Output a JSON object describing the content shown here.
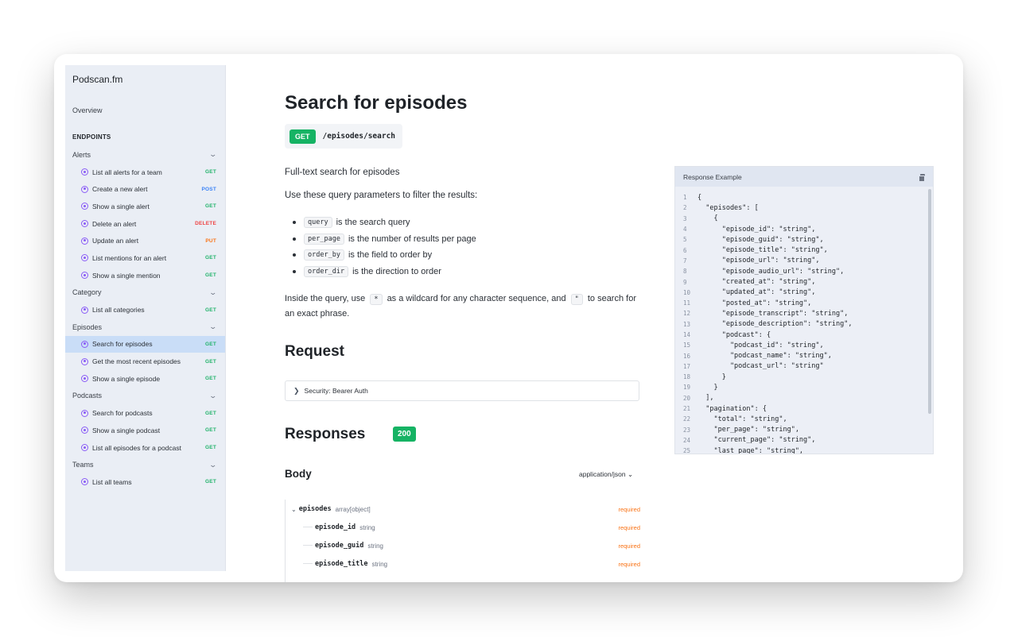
{
  "sidebar": {
    "brand": "Podscan.fm",
    "overview": "Overview",
    "endpoints_heading": "ENDPOINTS",
    "groups": [
      {
        "label": "Alerts",
        "items": [
          {
            "label": "List all alerts for a team",
            "method": "GET"
          },
          {
            "label": "Create a new alert",
            "method": "POST"
          },
          {
            "label": "Show a single alert",
            "method": "GET"
          },
          {
            "label": "Delete an alert",
            "method": "DELETE"
          },
          {
            "label": "Update an alert",
            "method": "PUT"
          },
          {
            "label": "List mentions for an alert",
            "method": "GET"
          },
          {
            "label": "Show a single mention",
            "method": "GET"
          }
        ]
      },
      {
        "label": "Category",
        "items": [
          {
            "label": "List all categories",
            "method": "GET"
          }
        ]
      },
      {
        "label": "Episodes",
        "items": [
          {
            "label": "Search for episodes",
            "method": "GET",
            "active": true
          },
          {
            "label": "Get the most recent episodes",
            "method": "GET"
          },
          {
            "label": "Show a single episode",
            "method": "GET"
          }
        ]
      },
      {
        "label": "Podcasts",
        "items": [
          {
            "label": "Search for podcasts",
            "method": "GET"
          },
          {
            "label": "Show a single podcast",
            "method": "GET"
          },
          {
            "label": "List all episodes for a podcast",
            "method": "GET"
          }
        ]
      },
      {
        "label": "Teams",
        "items": [
          {
            "label": "List all teams",
            "method": "GET"
          }
        ]
      }
    ]
  },
  "main": {
    "title": "Search for episodes",
    "method": "GET",
    "path": "/episodes/search",
    "description": "Full-text search for episodes",
    "params_intro": "Use these query parameters to filter the results:",
    "params": [
      {
        "code": "query",
        "text": "is the search query"
      },
      {
        "code": "per_page",
        "text": "is the number of results per page"
      },
      {
        "code": "order_by",
        "text": "is the field to order by"
      },
      {
        "code": "order_dir",
        "text": "is the direction to order"
      }
    ],
    "wildcard": {
      "before": "Inside the query, use",
      "code1": "*",
      "middle": "as a wildcard for any character sequence, and",
      "code2": "\"",
      "after": "to search for an exact phrase."
    },
    "request_heading": "Request",
    "security_label": "Security: Bearer Auth",
    "responses_heading": "Responses",
    "status_code": "200",
    "body_heading": "Body",
    "content_type": "application/json",
    "schema": [
      {
        "name": "episodes",
        "type": "array[object]",
        "required": "required",
        "level": 0
      },
      {
        "name": "episode_id",
        "type": "string",
        "required": "required",
        "level": 1
      },
      {
        "name": "episode_guid",
        "type": "string",
        "required": "required",
        "level": 1
      },
      {
        "name": "episode_title",
        "type": "string",
        "required": "required",
        "level": 1
      }
    ]
  },
  "response_example": {
    "title": "Response Example",
    "lines": [
      "{",
      "  \"episodes\": [",
      "    {",
      "      \"episode_id\": \"string\",",
      "      \"episode_guid\": \"string\",",
      "      \"episode_title\": \"string\",",
      "      \"episode_url\": \"string\",",
      "      \"episode_audio_url\": \"string\",",
      "      \"created_at\": \"string\",",
      "      \"updated_at\": \"string\",",
      "      \"posted_at\": \"string\",",
      "      \"episode_transcript\": \"string\",",
      "      \"episode_description\": \"string\",",
      "      \"podcast\": {",
      "        \"podcast_id\": \"string\",",
      "        \"podcast_name\": \"string\",",
      "        \"podcast_url\": \"string\"",
      "      }",
      "    }",
      "  ],",
      "  \"pagination\": {",
      "    \"total\": \"string\",",
      "    \"per_page\": \"string\",",
      "    \"current_page\": \"string\",",
      "    \"last_page\": \"string\","
    ]
  },
  "colors": {
    "get": "#22b36b",
    "post": "#3b82f6",
    "delete": "#ef4444",
    "put": "#f97316",
    "accent_green": "#16b364",
    "sidebar_active": "#c9ddf7"
  }
}
